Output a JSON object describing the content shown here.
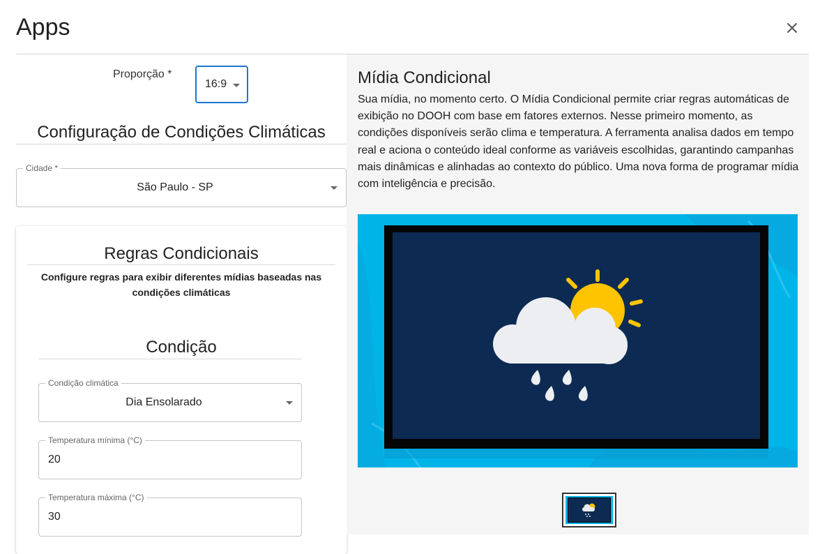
{
  "header": {
    "title": "Apps"
  },
  "left": {
    "proportion": {
      "label": "Proporção *",
      "value": "16:9"
    },
    "climate_config_title": "Configuração de Condições Climáticas",
    "city": {
      "label": "Cidade *",
      "value": "São Paulo - SP"
    },
    "rules": {
      "title": "Regras Condicionais",
      "description": "Configure regras para exibir diferentes mídias baseadas nas condições climáticas",
      "condition": {
        "title": "Condição",
        "climate": {
          "label": "Condição climática",
          "value": "Dia Ensolarado"
        },
        "temp_min": {
          "label": "Temperatura mínima (°C)",
          "value": "20"
        },
        "temp_max": {
          "label": "Temperatura máxima (°C)",
          "value": "30"
        }
      }
    }
  },
  "right": {
    "title": "Mídia Condicional",
    "description": "Sua mídia, no momento certo. O Mídia Condicional permite criar regras automáticas de exibição no DOOH com base em fatores externos. Nesse primeiro momento, as condições disponíveis serão clima e temperatura. A ferramenta analisa dados em tempo real e aciona o conteúdo ideal conforme as variáveis escolhidas, garantindo campanhas mais dinâmicas e alinhadas ao contexto do público. Uma nova forma de programar mídia com inteligência e precisão."
  },
  "icons": [
    "close-icon",
    "chevron-down-icon",
    "weather-cloud-sun-rain-icon"
  ],
  "colors": {
    "accent": "#1976d2",
    "preview_bg": "#00b4e8",
    "screen_bg": "#0d2a52",
    "sun": "#ffc400",
    "cloud": "#eceef1"
  }
}
